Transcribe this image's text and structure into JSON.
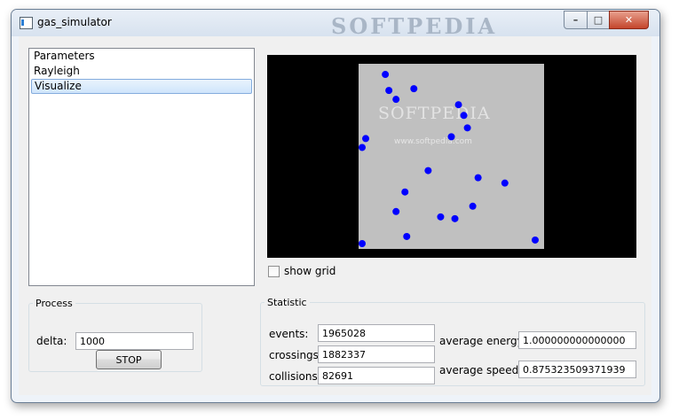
{
  "window": {
    "title": "gas_simulator",
    "watermark": "SOFTPEDIA"
  },
  "controls": {
    "minimize": "–",
    "maximize": "□",
    "close": "✕"
  },
  "sidebar": {
    "items": [
      "Parameters",
      "Rayleigh",
      "Visualize"
    ],
    "selected_index": 2
  },
  "visualization": {
    "watermark": "SOFTPEDIA",
    "watermark_sub": "www.softpedia.com",
    "particle_color": "#0000ff",
    "background_color": "#000000",
    "area_color": "#c0c0c0",
    "particles": [
      [
        0.13,
        0.04
      ],
      [
        0.29,
        0.12
      ],
      [
        0.15,
        0.13
      ],
      [
        0.19,
        0.18
      ],
      [
        0.54,
        0.21
      ],
      [
        0.57,
        0.27
      ],
      [
        0.59,
        0.34
      ],
      [
        0.5,
        0.39
      ],
      [
        0.02,
        0.4
      ],
      [
        0.0,
        0.45
      ],
      [
        0.37,
        0.58
      ],
      [
        0.65,
        0.62
      ],
      [
        0.8,
        0.65
      ],
      [
        0.24,
        0.7
      ],
      [
        0.62,
        0.78
      ],
      [
        0.19,
        0.81
      ],
      [
        0.44,
        0.84
      ],
      [
        0.52,
        0.85
      ],
      [
        0.25,
        0.95
      ],
      [
        0.97,
        0.97
      ],
      [
        0.0,
        0.99
      ]
    ]
  },
  "show_grid": {
    "label": "show grid",
    "checked": false
  },
  "process": {
    "legend": "Process",
    "delta_label": "delta:",
    "delta_value": "1000",
    "stop_label": "STOP"
  },
  "statistic": {
    "legend": "Statistic",
    "events_label": "events:",
    "events_value": "1965028",
    "crossings_label": "crossings:",
    "crossings_value": "1882337",
    "collisions_label": "collisions:",
    "collisions_value": "82691",
    "avg_energy_label": "average energy:",
    "avg_energy_value": "1.000000000000000",
    "avg_speed_label": "average speed:",
    "avg_speed_value": "0.875323509371939"
  }
}
